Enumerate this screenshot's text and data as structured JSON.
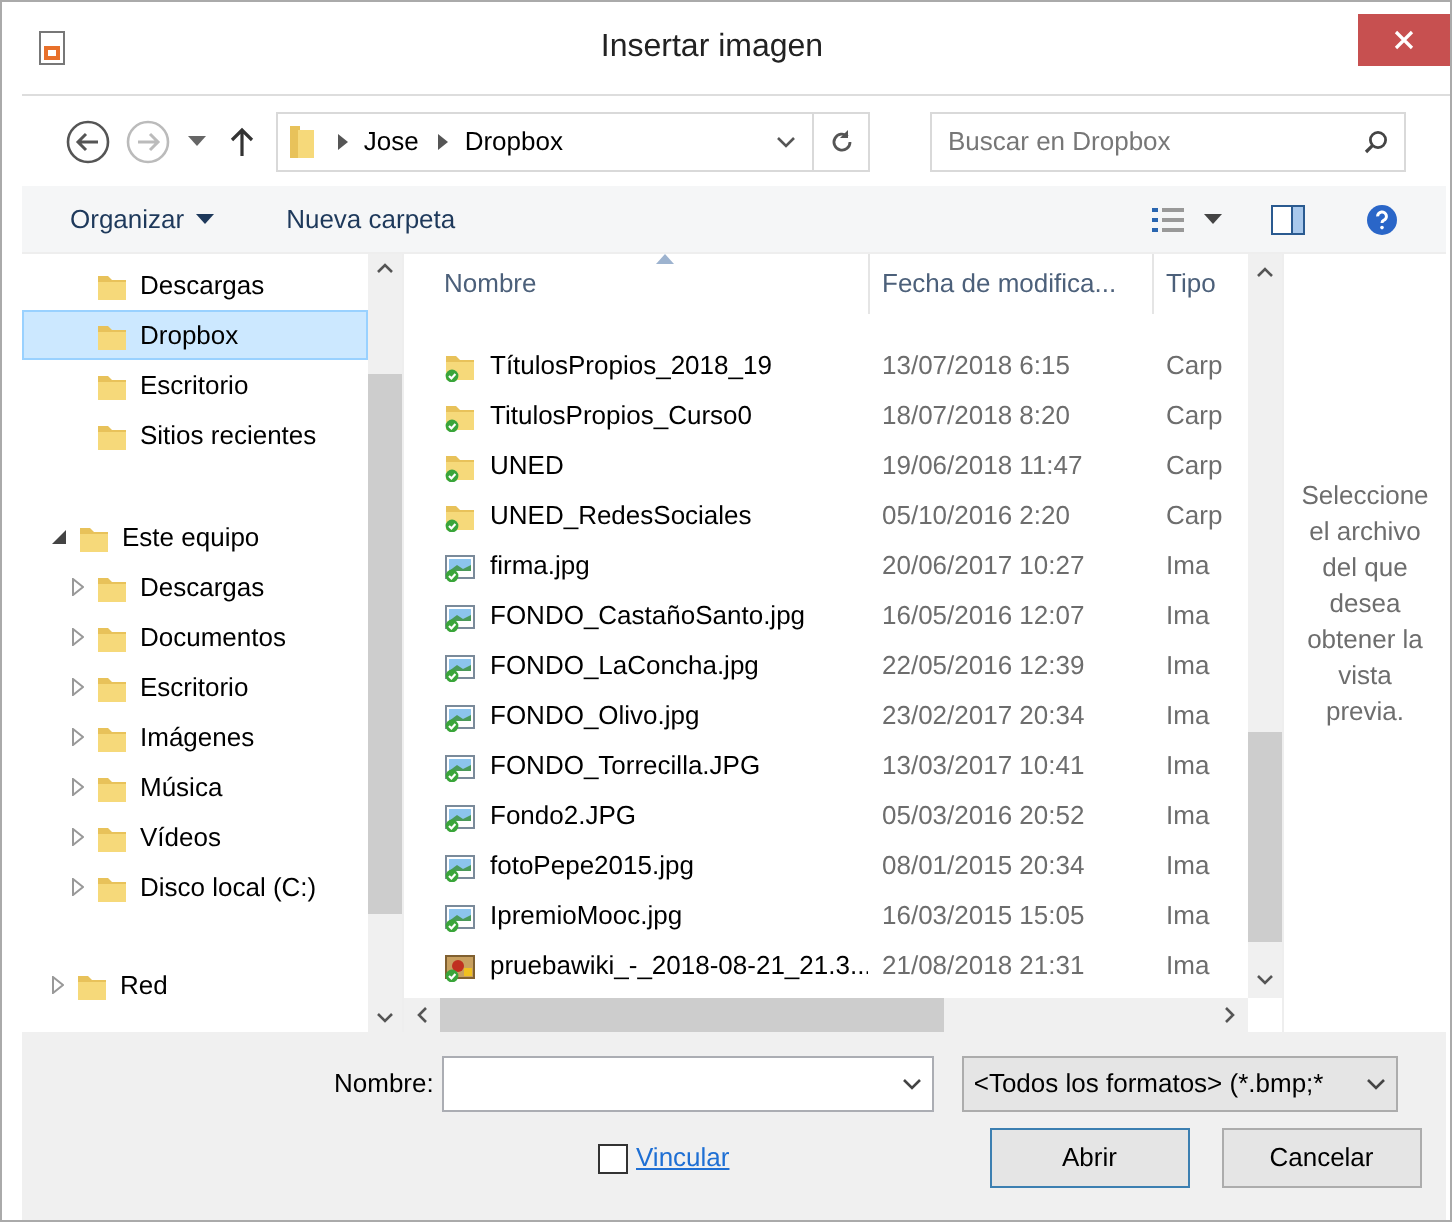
{
  "window": {
    "title": "Insertar imagen"
  },
  "address_bar": {
    "path": [
      "Jose",
      "Dropbox"
    ]
  },
  "search": {
    "placeholder": "Buscar en Dropbox"
  },
  "toolbar": {
    "organize": "Organizar",
    "new_folder": "Nueva carpeta"
  },
  "sidebar": {
    "items": [
      {
        "label": "Descargas",
        "selected": false
      },
      {
        "label": "Dropbox",
        "selected": true
      },
      {
        "label": "Escritorio",
        "selected": false
      },
      {
        "label": "Sitios recientes",
        "selected": false
      },
      {
        "label": "Este equipo",
        "selected": false,
        "expanded": true,
        "children": [
          {
            "label": "Descargas",
            "selected": false,
            "expanded": false
          },
          {
            "label": "Documentos",
            "selected": false,
            "expanded": false
          },
          {
            "label": "Escritorio",
            "selected": false,
            "expanded": false
          },
          {
            "label": "Imágenes",
            "selected": false,
            "expanded": false
          },
          {
            "label": "Música",
            "selected": false,
            "expanded": false
          },
          {
            "label": "Vídeos",
            "selected": false,
            "expanded": false
          },
          {
            "label": "Disco local (C:)",
            "selected": false,
            "expanded": false
          }
        ]
      },
      {
        "label": "Red",
        "selected": false,
        "expanded": false
      }
    ]
  },
  "table": {
    "columns": [
      "Nombre",
      "Fecha de modifica...",
      "Tipo"
    ],
    "rows": [
      {
        "kind": "folder",
        "cells": [
          "TítulosPropios_2018_19",
          "13/07/2018 6:15",
          "Carp"
        ]
      },
      {
        "kind": "folder",
        "cells": [
          "TitulosPropios_Curso0",
          "18/07/2018 8:20",
          "Carp"
        ]
      },
      {
        "kind": "folder",
        "cells": [
          "UNED",
          "19/06/2018 11:47",
          "Carp"
        ]
      },
      {
        "kind": "folder",
        "cells": [
          "UNED_RedesSociales",
          "05/10/2016 2:20",
          "Carp"
        ]
      },
      {
        "kind": "image",
        "cells": [
          "firma.jpg",
          "20/06/2017 10:27",
          "Ima"
        ]
      },
      {
        "kind": "image",
        "cells": [
          "FONDO_CastañoSanto.jpg",
          "16/05/2016 12:07",
          "Ima"
        ]
      },
      {
        "kind": "image",
        "cells": [
          "FONDO_LaConcha.jpg",
          "22/05/2016 12:39",
          "Ima"
        ]
      },
      {
        "kind": "image",
        "cells": [
          "FONDO_Olivo.jpg",
          "23/02/2017 20:34",
          "Ima"
        ]
      },
      {
        "kind": "image",
        "cells": [
          "FONDO_Torrecilla.JPG",
          "13/03/2017 10:41",
          "Ima"
        ]
      },
      {
        "kind": "image",
        "cells": [
          "Fondo2.JPG",
          "05/03/2016 20:52",
          "Ima"
        ]
      },
      {
        "kind": "image",
        "cells": [
          "fotoPepe2015.jpg",
          "08/01/2015 20:34",
          "Ima"
        ]
      },
      {
        "kind": "image",
        "cells": [
          "IpremioMooc.jpg",
          "16/03/2015 15:05",
          "Ima"
        ]
      },
      {
        "kind": "picture",
        "cells": [
          "pruebawiki_-_2018-08-21_21.3...",
          "21/08/2018 21:31",
          "Ima"
        ]
      }
    ]
  },
  "preview": {
    "message": "Seleccione el archivo del que desea obtener la vista previa."
  },
  "footer": {
    "name_label": "Nombre:",
    "filter": "<Todos los formatos> (*.bmp;*",
    "link_checkbox": {
      "label": "Vincular",
      "checked": false
    },
    "buttons": [
      "Abrir",
      "Cancelar"
    ]
  }
}
